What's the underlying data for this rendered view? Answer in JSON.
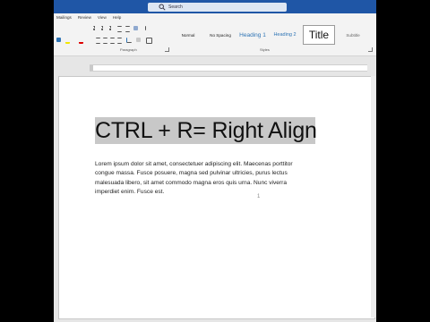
{
  "search": {
    "label": "Search"
  },
  "tabs": [
    "Mailings",
    "Review",
    "View",
    "Help"
  ],
  "styles_gallery": [
    "Normal",
    "No Spacing",
    "Heading 1",
    "Heading 2",
    "Title",
    "Subtitle"
  ],
  "groups": {
    "paragraph": "Paragraph",
    "styles": "Styles"
  },
  "document": {
    "heading": "CTRL + R=  Right Align",
    "body_lines": [
      "Lorem ipsum dolor sit amet, consectetuer adipiscing elit. Maecenas porttitor",
      "congue massa. Fusce posuere, magna sed pulvinar ultricies, purus lectus",
      "malesuada libero, sit amet commodo magna eros quis urna. Nunc viverra",
      "imperdiet enim. Fusce est."
    ],
    "marker": "1"
  },
  "colors": {
    "titlebar": "#1f56a6",
    "heading_highlight": "#c8c8c8",
    "accent_blue": "#2e74b5"
  }
}
